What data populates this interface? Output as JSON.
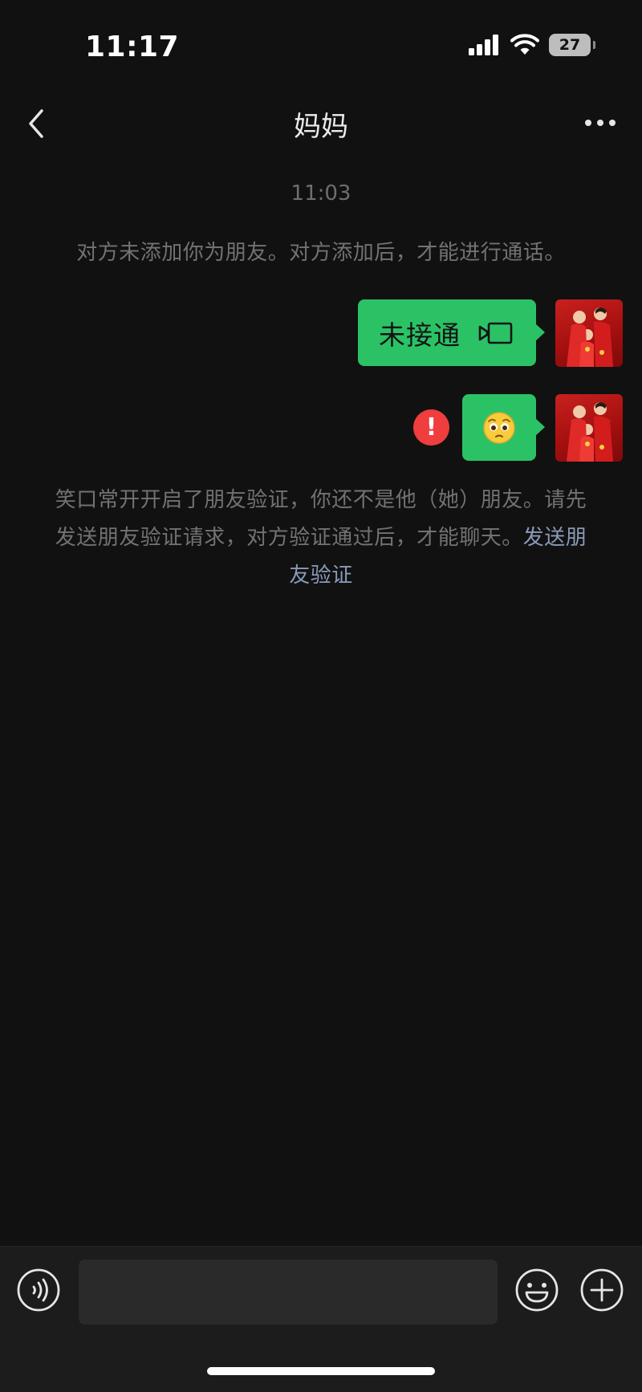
{
  "status_bar": {
    "time": "11:17",
    "battery": "27"
  },
  "nav": {
    "title": "妈妈",
    "back_icon": "chevron-left-icon",
    "more_icon": "more-dots-icon"
  },
  "messages": {
    "timestamp": "11:03",
    "call_notice": "对方未添加你为朋友。对方添加后，才能进行通话。",
    "call_bubble": {
      "text": "未接通",
      "icon": "video-call-icon"
    },
    "emoji_bubble": {
      "emoji": "🥺",
      "error_icon": "!"
    },
    "verify_notice": {
      "text": "笑口常开开启了朋友验证，你还不是他（她）朋友。请先发送朋友验证请求，对方验证通过后，才能聊天。",
      "link": "发送朋友验证"
    }
  },
  "input_bar": {
    "value": "",
    "voice_icon": "voice-icon",
    "emoji_icon": "emoji-icon",
    "plus_icon": "plus-icon"
  },
  "colors": {
    "background": "#111111",
    "bubble": "#2bc266",
    "link": "#8a9ab8",
    "error": "#f03d3d"
  }
}
